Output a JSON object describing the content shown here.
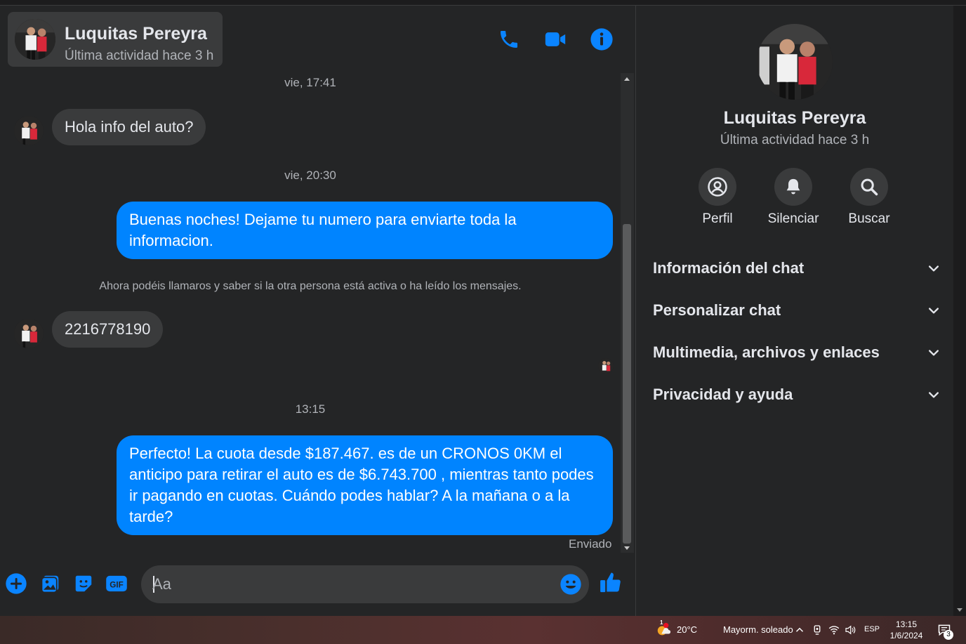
{
  "contact": {
    "name": "Luquitas Pereyra",
    "status": "Última actividad hace 3 h"
  },
  "header": {
    "actions": [
      "phone-icon",
      "video-icon",
      "info-icon"
    ]
  },
  "conversation": {
    "timestamps": [
      "vie, 17:41",
      "vie, 20:30",
      "13:15"
    ],
    "messages": [
      {
        "from": "contact",
        "text": "Hola info del auto?"
      },
      {
        "from": "me",
        "text": "Buenas noches! Dejame tu numero para enviarte toda la informacion."
      },
      {
        "from": "contact",
        "text": "2216778190"
      },
      {
        "from": "me",
        "text": "Perfecto! La cuota desde $187.467. es de un CRONOS 0KM el anticipo para retirar el auto es de $6.743.700 , mientras tanto podes ir pagando en cuotas. Cuándo podes hablar? A la mañana o a la tarde?"
      }
    ],
    "notice": "Ahora podéis llamaros y saber si la otra persona está activa o ha leído los mensajes.",
    "delivery_status": "Enviado"
  },
  "composer": {
    "placeholder": "Aa",
    "buttons": [
      "plus-icon",
      "image-icon",
      "sticker-icon",
      "gif-icon"
    ],
    "gif_label": "GIF"
  },
  "panel": {
    "actions": [
      {
        "label": "Perfil",
        "icon": "profile-icon"
      },
      {
        "label": "Silenciar",
        "icon": "bell-icon"
      },
      {
        "label": "Buscar",
        "icon": "search-icon"
      }
    ],
    "sections": [
      "Información del chat",
      "Personalizar chat",
      "Multimedia, archivos y enlaces",
      "Privacidad y ayuda"
    ]
  },
  "taskbar": {
    "temperature": "20°C",
    "weather": "Mayorm. soleado",
    "language": "ESP",
    "time": "13:15",
    "date": "1/6/2024",
    "notification_count": "3",
    "weather_alert": "1"
  },
  "colors": {
    "accent": "#0084ff",
    "background": "#242526",
    "surface": "#3a3b3c",
    "text_primary": "#e4e6eb",
    "text_secondary": "#b0b3b8"
  }
}
